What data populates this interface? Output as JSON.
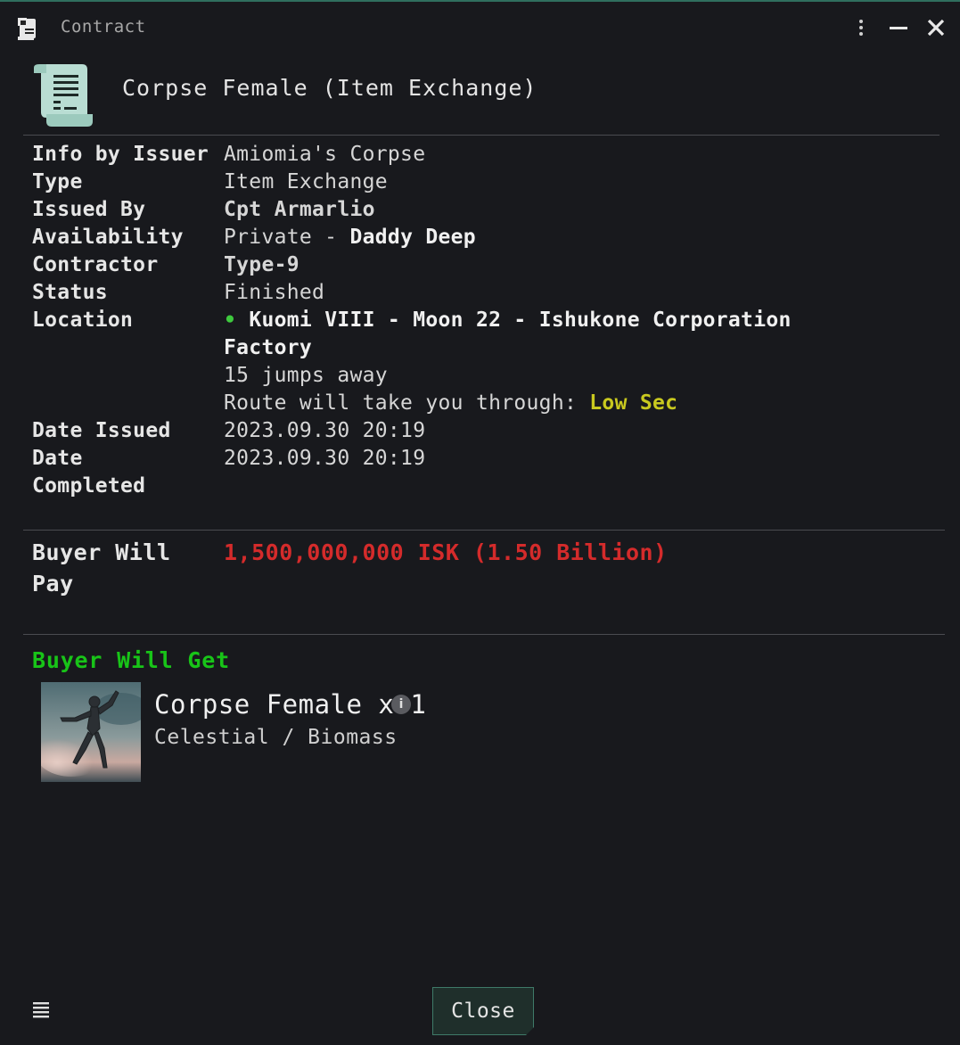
{
  "window": {
    "title": "Contract",
    "icons": {
      "app": "contract-scroll-icon",
      "more": "kebab-menu-icon",
      "minimize": "minimize-icon",
      "close": "close-icon"
    }
  },
  "header": {
    "icon": "contract-document-icon",
    "title": "Corpse Female (Item Exchange)"
  },
  "info": {
    "info_by_issuer": {
      "label": "Info by Issuer",
      "value": "Amiomia's Corpse"
    },
    "type": {
      "label": "Type",
      "value": "Item Exchange"
    },
    "issued_by": {
      "label": "Issued By",
      "value": "Cpt Armarlio"
    },
    "availability": {
      "label": "Availability",
      "prefix": "Private - ",
      "value": "Daddy Deep"
    },
    "contractor": {
      "label": "Contractor",
      "value": "Type-9"
    },
    "status": {
      "label": "Status",
      "value": "Finished"
    },
    "location": {
      "label": "Location",
      "bullet": "•",
      "line1": "Kuomi VIII - Moon 22 - Ishukone Corporation",
      "line2": "Factory",
      "jumps": "15 jumps away",
      "route_prefix": "Route will take you through: ",
      "route_sec": "Low Sec"
    },
    "date_issued": {
      "label": "Date Issued",
      "value": "2023.09.30 20:19"
    },
    "date_completed": {
      "label_line1": "Date",
      "label_line2": "Completed",
      "value": "2023.09.30 20:19"
    }
  },
  "payment": {
    "label_line1": "Buyer Will",
    "label_line2": "Pay",
    "value": "1,500,000,000 ISK (1.50 Billion)"
  },
  "receive": {
    "heading": "Buyer Will Get",
    "item": {
      "name": "Corpse Female x 1",
      "category": "Celestial / Biomass",
      "info_glyph": "i"
    }
  },
  "footer": {
    "menu_icon": "hamburger-menu-icon",
    "close_label": "Close"
  },
  "colors": {
    "accent": "#2f6f5e",
    "price": "#d42b2b",
    "buyer_get": "#18c418",
    "low_sec": "#c9c91f"
  }
}
